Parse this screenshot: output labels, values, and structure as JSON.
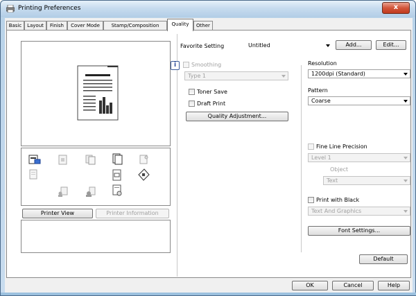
{
  "window": {
    "title": "Printing Preferences",
    "close_label": "x"
  },
  "tabs": [
    {
      "label": "Basic"
    },
    {
      "label": "Layout"
    },
    {
      "label": "Finish"
    },
    {
      "label": "Cover Mode"
    },
    {
      "label": "Stamp/Composition"
    },
    {
      "label": "Quality"
    },
    {
      "label": "Other"
    }
  ],
  "active_tab": "Quality",
  "preview": {
    "printer_view_label": "Printer View",
    "printer_info_label": "Printer Information"
  },
  "favorite": {
    "label": "Favorite Setting",
    "value": "Untitled",
    "add_label": "Add...",
    "edit_label": "Edit..."
  },
  "quality": {
    "smoothing_label": "Smoothing",
    "smoothing_value": "Type 1",
    "toner_save_label": "Toner Save",
    "draft_print_label": "Draft Print",
    "quality_adjust_label": "Quality Adjustment..."
  },
  "right": {
    "resolution_label": "Resolution",
    "resolution_value": "1200dpi (Standard)",
    "pattern_label": "Pattern",
    "pattern_value": "Coarse",
    "fine_line_label": "Fine Line Precision",
    "fine_line_value": "Level 1",
    "object_label": "Object",
    "object_value": "Text",
    "print_black_label": "Print with Black",
    "print_black_value": "Text And Graphics",
    "font_settings_label": "Font Settings..."
  },
  "footer": {
    "default_label": "Default",
    "ok_label": "OK",
    "cancel_label": "Cancel",
    "help_label": "Help"
  }
}
